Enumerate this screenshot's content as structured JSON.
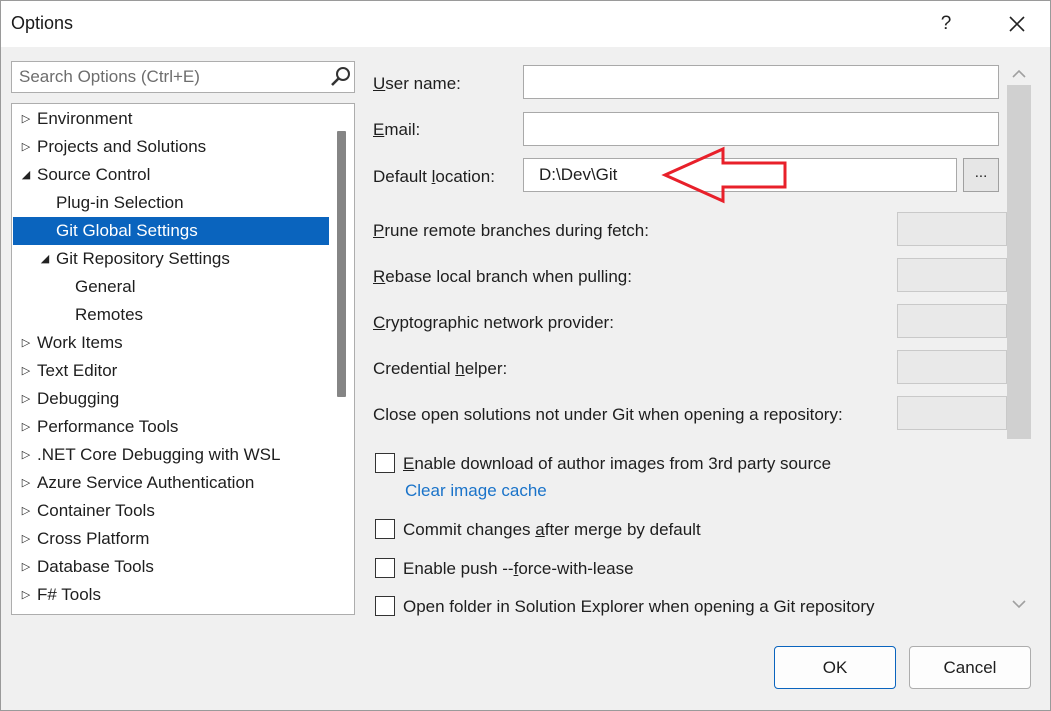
{
  "window": {
    "title": "Options",
    "help_label": "?"
  },
  "search": {
    "placeholder": "Search Options (Ctrl+E)"
  },
  "tree": {
    "items": [
      {
        "label": "Environment",
        "arrow": "▷"
      },
      {
        "label": "Projects and Solutions",
        "arrow": "▷"
      },
      {
        "label": "Source Control",
        "arrow": "◢"
      },
      {
        "label": "Plug-in Selection",
        "arrow": ""
      },
      {
        "label": "Git Global Settings",
        "arrow": "",
        "selected": true
      },
      {
        "label": "Git Repository Settings",
        "arrow": "◢"
      },
      {
        "label": "General",
        "arrow": ""
      },
      {
        "label": "Remotes",
        "arrow": ""
      },
      {
        "label": "Work Items",
        "arrow": "▷"
      },
      {
        "label": "Text Editor",
        "arrow": "▷"
      },
      {
        "label": "Debugging",
        "arrow": "▷"
      },
      {
        "label": "Performance Tools",
        "arrow": "▷"
      },
      {
        "label": ".NET Core Debugging with WSL",
        "arrow": "▷"
      },
      {
        "label": "Azure Service Authentication",
        "arrow": "▷"
      },
      {
        "label": "Container Tools",
        "arrow": "▷"
      },
      {
        "label": "Cross Platform",
        "arrow": "▷"
      },
      {
        "label": "Database Tools",
        "arrow": "▷"
      },
      {
        "label": "F# Tools",
        "arrow": "▷"
      }
    ]
  },
  "form": {
    "user_name": {
      "label_u": "U",
      "label_rest": "ser name:",
      "value": ""
    },
    "email": {
      "label_u": "E",
      "label_rest": "mail:",
      "value": ""
    },
    "default_location": {
      "label_pre": "Default ",
      "label_u": "l",
      "label_rest": "ocation:",
      "value": "D:\\Dev\\Git",
      "browse_label": "..."
    },
    "prune": {
      "label_u": "P",
      "label_rest": "rune remote branches during fetch:"
    },
    "rebase": {
      "label_u": "R",
      "label_rest": "ebase local branch when pulling:"
    },
    "crypto": {
      "label_u": "C",
      "label_rest": "ryptographic network provider:"
    },
    "credential": {
      "label_pre": "Credential ",
      "label_u": "h",
      "label_rest": "elper:"
    },
    "close_open": {
      "label": "Close open solutions not under Git when opening a repository:"
    }
  },
  "checkboxes": {
    "author_images": {
      "label_u": "E",
      "label_rest": "nable download of author images from 3rd party source",
      "checked": false
    },
    "clear_cache": {
      "label": "Clear image cache"
    },
    "commit_after_merge": {
      "label_pre": "Commit changes ",
      "label_u": "a",
      "label_rest": "fter merge by default",
      "checked": false
    },
    "force_with_lease": {
      "label_pre": "Enable push --",
      "label_u": "f",
      "label_rest": "orce-with-lease",
      "checked": false
    },
    "open_folder": {
      "label": "Open folder in Solution Explorer when opening a Git repository",
      "checked": false
    }
  },
  "buttons": {
    "ok": "OK",
    "cancel": "Cancel"
  },
  "colors": {
    "selection": "#0a64be",
    "link": "#1a73c9",
    "annotation_arrow": "#e8202a"
  }
}
